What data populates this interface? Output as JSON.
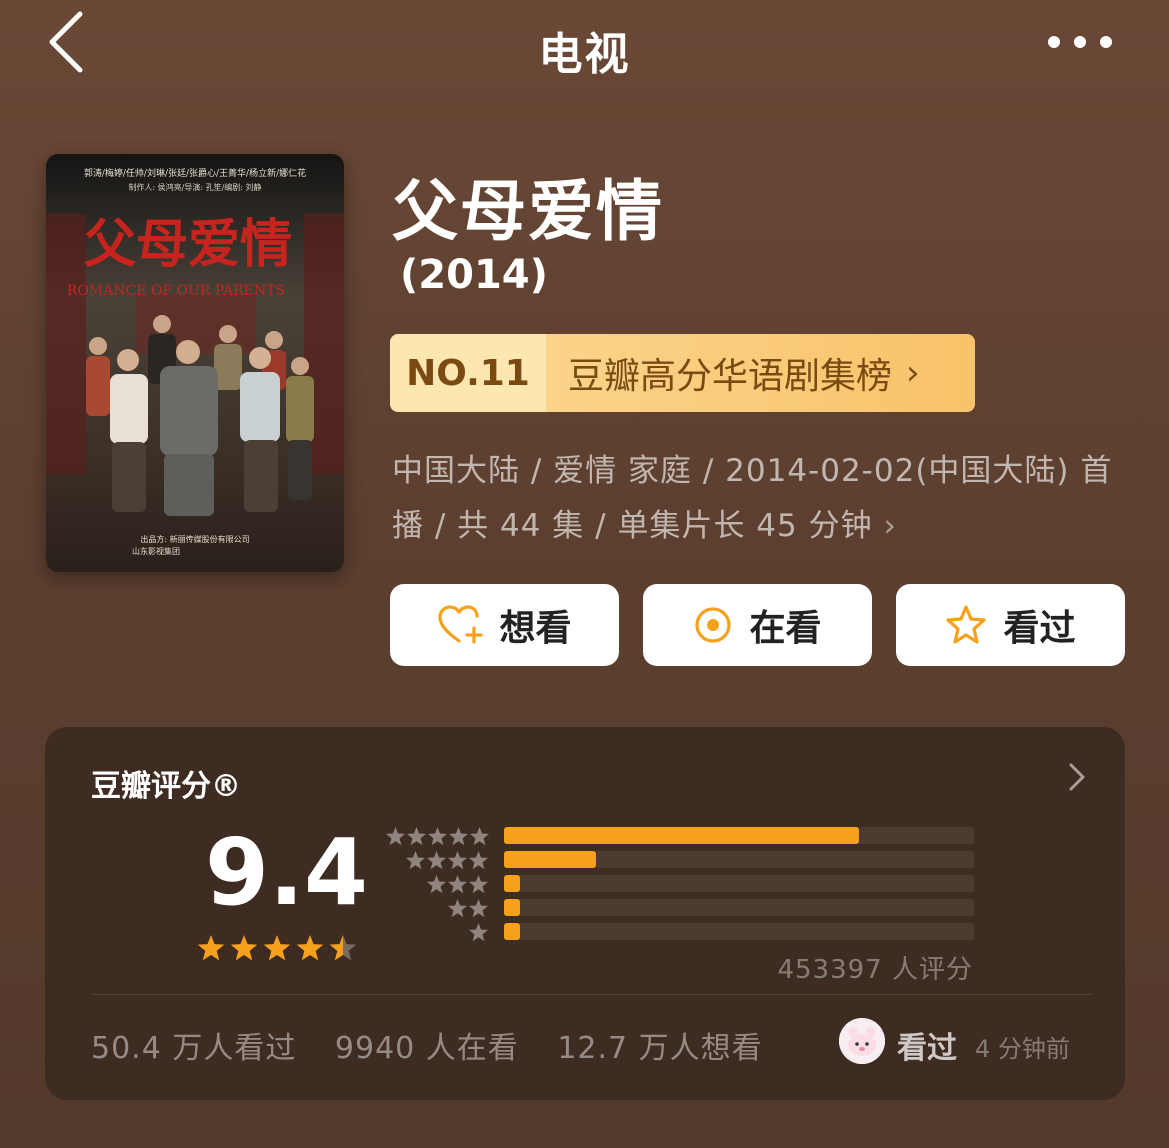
{
  "nav": {
    "title": "电视"
  },
  "poster": {
    "cast_line": "郭涛/梅婷/任帅/刘琳/张廷/张爵心/王菁华/杨立新/娜仁花",
    "crew_line": "制作人: 侯鸿亮/导演: 孔笙/编剧: 刘静",
    "title_cn": "父母爱情",
    "title_en": "ROMANCE OF OUR PARENTS",
    "producer_line1": "出品方: 新丽传媒股份有限公司",
    "producer_line2": "山东影视集团"
  },
  "title": "父母爱情",
  "year": "(2014)",
  "ranking": {
    "number": "NO.11",
    "label": "豆瓣高分华语剧集榜",
    "chevron": "›"
  },
  "meta": {
    "text": "中国大陆 / 爱情 家庭 / 2014-02-02(中国大陆) 首播 / 共 44 集 / 单集片长 45 分钟",
    "chevron": "›"
  },
  "actions": {
    "want": {
      "label": "想看",
      "icon": "heart-plus-icon"
    },
    "watching": {
      "label": "在看",
      "icon": "target-icon"
    },
    "watched": {
      "label": "看过",
      "icon": "star-outline-icon"
    }
  },
  "rating": {
    "title": "豆瓣评分®",
    "score": "9.4",
    "stars": 4.5,
    "distribution": [
      {
        "stars": 5,
        "fraction": 0.755
      },
      {
        "stars": 4,
        "fraction": 0.195
      },
      {
        "stars": 3,
        "fraction": 0.035
      },
      {
        "stars": 2,
        "fraction": 0.035
      },
      {
        "stars": 1,
        "fraction": 0.035
      }
    ],
    "raters": "453397 人评分",
    "accent_color": "#f5a11c"
  },
  "stats": {
    "watched": "50.4 万人看过",
    "watching": "9940 人在看",
    "want": "12.7 万人想看"
  },
  "recent": {
    "status": "看过",
    "time": "4 分钟前"
  }
}
